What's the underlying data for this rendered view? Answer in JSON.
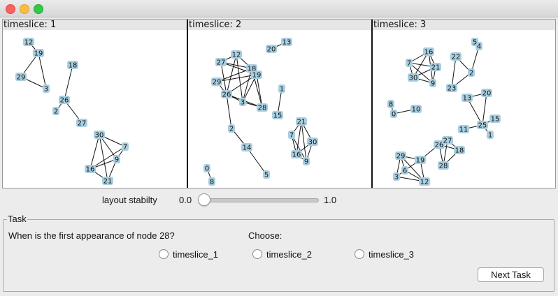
{
  "window": {
    "buttons": [
      "close",
      "minimize",
      "maximize"
    ]
  },
  "panels": [
    {
      "label": "timeslice: 1",
      "nodes": {
        "12": "12",
        "19": "19",
        "29": "29",
        "3": "3",
        "18": "18",
        "26": "26",
        "2": "2",
        "27": "27",
        "30": "30",
        "7": "7",
        "9": "9",
        "16": "16",
        "21": "21"
      },
      "edges": [
        [
          "12",
          "19"
        ],
        [
          "19",
          "29"
        ],
        [
          "19",
          "3"
        ],
        [
          "29",
          "3"
        ],
        [
          "18",
          "26"
        ],
        [
          "26",
          "2"
        ],
        [
          "26",
          "27"
        ],
        [
          "30",
          "7"
        ],
        [
          "30",
          "9"
        ],
        [
          "30",
          "16"
        ],
        [
          "30",
          "21"
        ],
        [
          "7",
          "9"
        ],
        [
          "7",
          "16"
        ],
        [
          "9",
          "16"
        ],
        [
          "9",
          "21"
        ],
        [
          "16",
          "21"
        ]
      ]
    },
    {
      "label": "timeslice: 2",
      "nodes": {
        "20": "20",
        "13": "13",
        "12": "12",
        "27": "27",
        "18": "18",
        "29": "29",
        "19": "19",
        "26": "26",
        "3": "3",
        "28": "28",
        "1": "1",
        "15": "15",
        "2": "2",
        "14": "14",
        "5": "5",
        "0": "0",
        "8": "8",
        "21": "21",
        "7": "7",
        "30": "30",
        "16": "16",
        "9": "9"
      },
      "edges": [
        [
          "20",
          "13"
        ],
        [
          "12",
          "27"
        ],
        [
          "12",
          "18"
        ],
        [
          "12",
          "26"
        ],
        [
          "12",
          "3"
        ],
        [
          "27",
          "18"
        ],
        [
          "27",
          "19"
        ],
        [
          "27",
          "26"
        ],
        [
          "18",
          "19"
        ],
        [
          "18",
          "3"
        ],
        [
          "18",
          "28"
        ],
        [
          "29",
          "18"
        ],
        [
          "29",
          "19"
        ],
        [
          "29",
          "26"
        ],
        [
          "19",
          "26"
        ],
        [
          "19",
          "3"
        ],
        [
          "19",
          "28"
        ],
        [
          "26",
          "3"
        ],
        [
          "26",
          "28"
        ],
        [
          "3",
          "28"
        ],
        [
          "1",
          "15"
        ],
        [
          "26",
          "2"
        ],
        [
          "2",
          "14"
        ],
        [
          "14",
          "5"
        ],
        [
          "0",
          "8"
        ],
        [
          "21",
          "7"
        ],
        [
          "21",
          "30"
        ],
        [
          "21",
          "16"
        ],
        [
          "21",
          "9"
        ],
        [
          "7",
          "16"
        ],
        [
          "7",
          "9"
        ],
        [
          "30",
          "16"
        ],
        [
          "30",
          "9"
        ],
        [
          "16",
          "9"
        ]
      ]
    },
    {
      "label": "timeslice: 3",
      "nodes": {
        "5": "5",
        "4": "4",
        "16": "16",
        "22": "22",
        "7": "7",
        "21": "21",
        "2": "2",
        "30": "30",
        "9": "9",
        "23": "23",
        "20": "20",
        "13": "13",
        "8": "8",
        "10": "10",
        "0": "0",
        "15": "15",
        "25": "25",
        "11": "11",
        "1": "1",
        "27": "27",
        "26": "26",
        "18": "18",
        "29": "29",
        "19": "19",
        "28": "28",
        "6": "6",
        "3": "3",
        "12": "12"
      },
      "edges": [
        [
          "5",
          "4"
        ],
        [
          "4",
          "2"
        ],
        [
          "22",
          "2"
        ],
        [
          "22",
          "23"
        ],
        [
          "2",
          "23"
        ],
        [
          "16",
          "7"
        ],
        [
          "16",
          "21"
        ],
        [
          "16",
          "30"
        ],
        [
          "16",
          "9"
        ],
        [
          "7",
          "21"
        ],
        [
          "7",
          "30"
        ],
        [
          "7",
          "9"
        ],
        [
          "21",
          "30"
        ],
        [
          "21",
          "9"
        ],
        [
          "30",
          "9"
        ],
        [
          "8",
          "0"
        ],
        [
          "0",
          "10"
        ],
        [
          "13",
          "20"
        ],
        [
          "13",
          "25"
        ],
        [
          "20",
          "25"
        ],
        [
          "15",
          "25"
        ],
        [
          "11",
          "25"
        ],
        [
          "25",
          "1"
        ],
        [
          "27",
          "26"
        ],
        [
          "27",
          "18"
        ],
        [
          "27",
          "28"
        ],
        [
          "26",
          "18"
        ],
        [
          "26",
          "28"
        ],
        [
          "18",
          "28"
        ],
        [
          "26",
          "19"
        ],
        [
          "29",
          "19"
        ],
        [
          "29",
          "6"
        ],
        [
          "29",
          "3"
        ],
        [
          "29",
          "12"
        ],
        [
          "19",
          "6"
        ],
        [
          "19",
          "12"
        ],
        [
          "6",
          "3"
        ],
        [
          "6",
          "12"
        ],
        [
          "3",
          "12"
        ]
      ]
    }
  ],
  "slider": {
    "label": "layout stabilty",
    "min_label": "0.0",
    "max_label": "1.0",
    "value": 0.0
  },
  "task": {
    "legend": "Task",
    "question": "When is the first appearance of node 28?",
    "choose_label": "Choose:",
    "options": [
      "timeslice_1",
      "timeslice_2",
      "timeslice_3"
    ],
    "next_button": "Next Task"
  }
}
